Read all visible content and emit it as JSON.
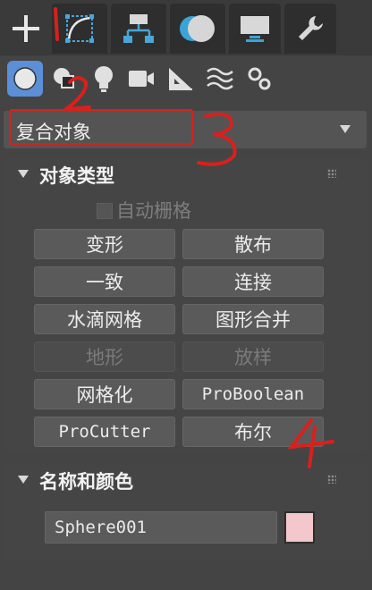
{
  "tabs": [
    {
      "icon": "plus-icon",
      "label": "Create",
      "active": true
    },
    {
      "icon": "modify-curve-icon",
      "label": "Modify"
    },
    {
      "icon": "hierarchy-icon",
      "label": "Hierarchy"
    },
    {
      "icon": "motion-icon",
      "label": "Motion"
    },
    {
      "icon": "display-icon",
      "label": "Display"
    },
    {
      "icon": "wrench-icon",
      "label": "Utilities"
    }
  ],
  "subtabs": [
    {
      "icon": "geometry-sphere-icon",
      "active": true
    },
    {
      "icon": "shapes-icon"
    },
    {
      "icon": "lights-icon"
    },
    {
      "icon": "camera-icon"
    },
    {
      "icon": "helpers-icon"
    },
    {
      "icon": "spacewarps-icon"
    },
    {
      "icon": "systems-icon"
    }
  ],
  "category_dropdown": {
    "value": "复合对象"
  },
  "object_type_panel": {
    "title": "对象类型",
    "autogrid_label": "自动栅格",
    "buttons": [
      {
        "label": "变形",
        "enabled": true
      },
      {
        "label": "散布",
        "enabled": true
      },
      {
        "label": "一致",
        "enabled": true
      },
      {
        "label": "连接",
        "enabled": true
      },
      {
        "label": "水滴网格",
        "enabled": true
      },
      {
        "label": "图形合并",
        "enabled": true
      },
      {
        "label": "地形",
        "enabled": false
      },
      {
        "label": "放样",
        "enabled": false
      },
      {
        "label": "网格化",
        "enabled": true
      },
      {
        "label": "ProBoolean",
        "enabled": true
      },
      {
        "label": "ProCutter",
        "enabled": true
      },
      {
        "label": "布尔",
        "enabled": true
      }
    ]
  },
  "name_color_panel": {
    "title": "名称和颜色",
    "name_value": "Sphere001",
    "color": "#f4c7cc"
  },
  "annotations": [
    "1",
    "2",
    "3",
    "4"
  ],
  "colors": {
    "accent": "#5b8fd8",
    "annotation_red": "#d9201c"
  }
}
